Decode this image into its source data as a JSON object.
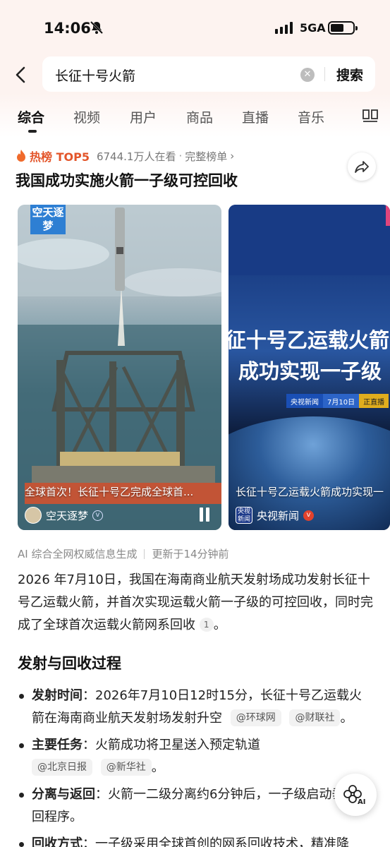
{
  "status_bar": {
    "time": "14:06",
    "network": "5GA",
    "battery_level": 0.6
  },
  "search": {
    "query": "长征十号火箭",
    "submit_label": "搜索"
  },
  "tabs": [
    "综合",
    "视频",
    "用户",
    "商品",
    "直播",
    "音乐"
  ],
  "hot_topic": {
    "badge_label": "热榜 TOP5",
    "viewers": "6744.1万人在看",
    "separator": "·",
    "full_list_label": "完整榜单",
    "title": "我国成功实施火箭一子级可控回收"
  },
  "videos": [
    {
      "logo_text": "空天逐梦",
      "caption": "全球首次！长征十号乙完成全球首...",
      "author": "空天逐梦"
    },
    {
      "headline_1": "征十号乙运载火箭",
      "headline_2": "成功实现一子级",
      "pill_1": "央视新闻",
      "pill_2": "7月10日",
      "pill_3": "正直播",
      "caption": "长征十号乙运载火箭成功实现一",
      "author": "央视新闻",
      "avatar_text": "央视新闻"
    }
  ],
  "ai_summary": {
    "source_note": "AI 综合全网权威信息生成",
    "updated": "更新于14分钟前",
    "text": "2026 年7月10日，我国在海南商业航天发射场成功发射长征十号乙运载火箭，并首次实现运载火箭一子级的可控回收，同时完成了全球首次运载火箭网系回收",
    "cite": "1",
    "end_punct": "。"
  },
  "section": {
    "title": "发射与回收过程",
    "items": [
      {
        "key": "发射时间",
        "colon": "：",
        "text": "2026年7月10日12时15分，长征十号乙运载火箭在海南商业航天发射场发射升空",
        "sources": [
          "@环球网",
          "@财联社"
        ],
        "end": "。"
      },
      {
        "key": "主要任务",
        "colon": "：",
        "text": "火箭成功将卫星送入预定轨道",
        "sources": [
          "@北京日报",
          "@新华社"
        ],
        "end": "。"
      },
      {
        "key": "分离与返回",
        "colon": "：",
        "text": "火箭一二级分离约6分钟后，一子级启动垂直返回程序。",
        "sources": [],
        "end": ""
      },
      {
        "key": "回收方式",
        "colon": "：",
        "text": "一子级采用全球首创的网系回收技术，精准降",
        "sources": [],
        "end": ""
      }
    ]
  },
  "ai_button_label": "AI"
}
